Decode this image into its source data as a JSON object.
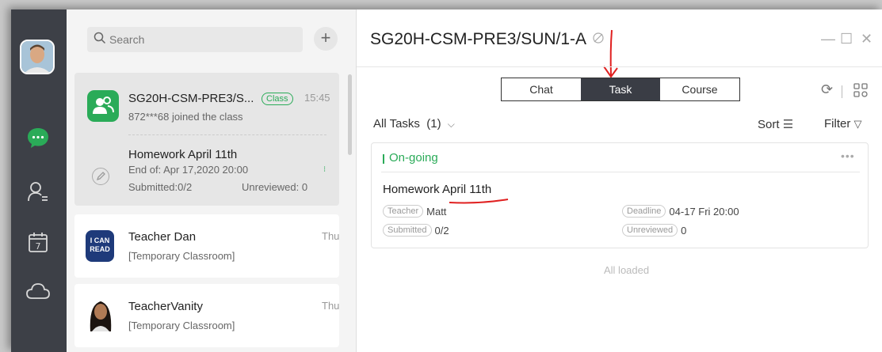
{
  "sidebar": {
    "icons": [
      "chat-icon",
      "contacts-icon",
      "calendar-icon",
      "cloud-icon"
    ],
    "calendar_day": "7"
  },
  "list": {
    "search_placeholder": "Search",
    "add_label": "+",
    "items": [
      {
        "title": "SG20H-CSM-PRE3/S...",
        "badge": "Class",
        "time": "15:45",
        "subtitle": "872***68 joined the class",
        "homework_title": "Homework April 11th",
        "homework_end": "End of: Apr 17,2020 20:00",
        "submitted": "Submitted:0/2",
        "unreviewed": "Unreviewed: 0"
      },
      {
        "title": "Teacher Dan",
        "time": "Thu",
        "subtitle": "[Temporary Classroom]",
        "logo_text": "I CAN READ"
      },
      {
        "title": "TeacherVanity",
        "time": "Thu",
        "subtitle": "[Temporary Classroom]"
      }
    ]
  },
  "main": {
    "title": "SG20H-CSM-PRE3/SUN/1-A",
    "tabs": [
      "Chat",
      "Task",
      "Course"
    ],
    "active_tab": "Task",
    "filter_label": "All Tasks",
    "filter_count": "(1)",
    "sort_label": "Sort",
    "filter_btn": "Filter",
    "task_section": "On-going",
    "task": {
      "title": "Homework April 11th",
      "teacher_label": "Teacher",
      "teacher": "Matt",
      "deadline_label": "Deadline",
      "deadline": "04-17 Fri 20:00",
      "submitted_label": "Submitted",
      "submitted": "0/2",
      "unreviewed_label": "Unreviewed",
      "unreviewed": "0"
    },
    "footer": "All loaded"
  },
  "colors": {
    "accent": "#2aab58",
    "rail": "#3d4047",
    "annotation": "#e02020"
  }
}
